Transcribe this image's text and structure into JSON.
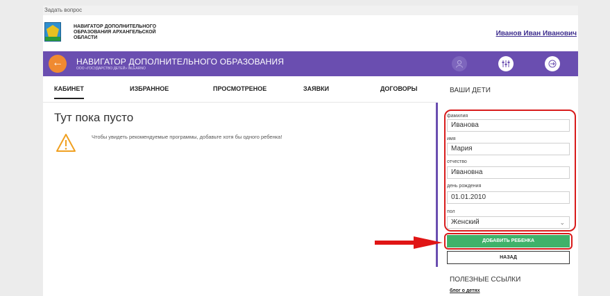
{
  "topbar": {
    "ask_label": "Задать вопрос"
  },
  "header": {
    "logo_text_line1": "НАВИГАТОР ДОПОЛНИТЕЛЬНОГО",
    "logo_text_line2": "ОБРАЗОВАНИЯ АРХАНГЕЛЬСКОЙ",
    "logo_text_line3": "ОБЛАСТИ",
    "user_name": "Иванов Иван Иванович"
  },
  "navbar": {
    "title": "НАВИГАТОР ДОПОЛНИТЕЛЬНОГО ОБРАЗОВАНИЯ",
    "subtitle": "ООО «ГОСУДАРСТВО ДЕТЕЙ» INLEARNO",
    "icons": [
      "arrow-left-icon",
      "user-icon",
      "filter-icon",
      "exit-icon"
    ],
    "accent": "#6a4eb0",
    "back_color": "#f08a30"
  },
  "tabs": [
    {
      "label": "КАБИНЕТ",
      "active": true
    },
    {
      "label": "ИЗБРАННОЕ"
    },
    {
      "label": "ПРОСМОТРЕНОЕ"
    },
    {
      "label": "ЗАЯВКИ"
    },
    {
      "label": "ДОГОВОРЫ"
    }
  ],
  "main": {
    "empty_title": "Тут пока пусто",
    "hint": "Чтобы увидеть рекомендуемые программы, добавьте хотя бы одного ребенка!"
  },
  "children": {
    "title": "ВАШИ ДЕТИ",
    "fields": [
      {
        "label": "фамилия",
        "value": "Иванова"
      },
      {
        "label": "имя",
        "value": "Мария"
      },
      {
        "label": "отчество",
        "value": "Ивановна"
      },
      {
        "label": "день рождения",
        "value": "01.01.2010"
      },
      {
        "label": "пол",
        "value": "Женский"
      }
    ],
    "add_button": "ДОБАВИТЬ РЕБЕНКА",
    "back_button": "НАЗАД",
    "add_color": "#3fb26a",
    "highlight_color": "#d81a1a"
  },
  "links": {
    "title": "ПОЛЕЗНЫЕ ССЫЛКИ",
    "items": [
      "блог о детях"
    ]
  }
}
